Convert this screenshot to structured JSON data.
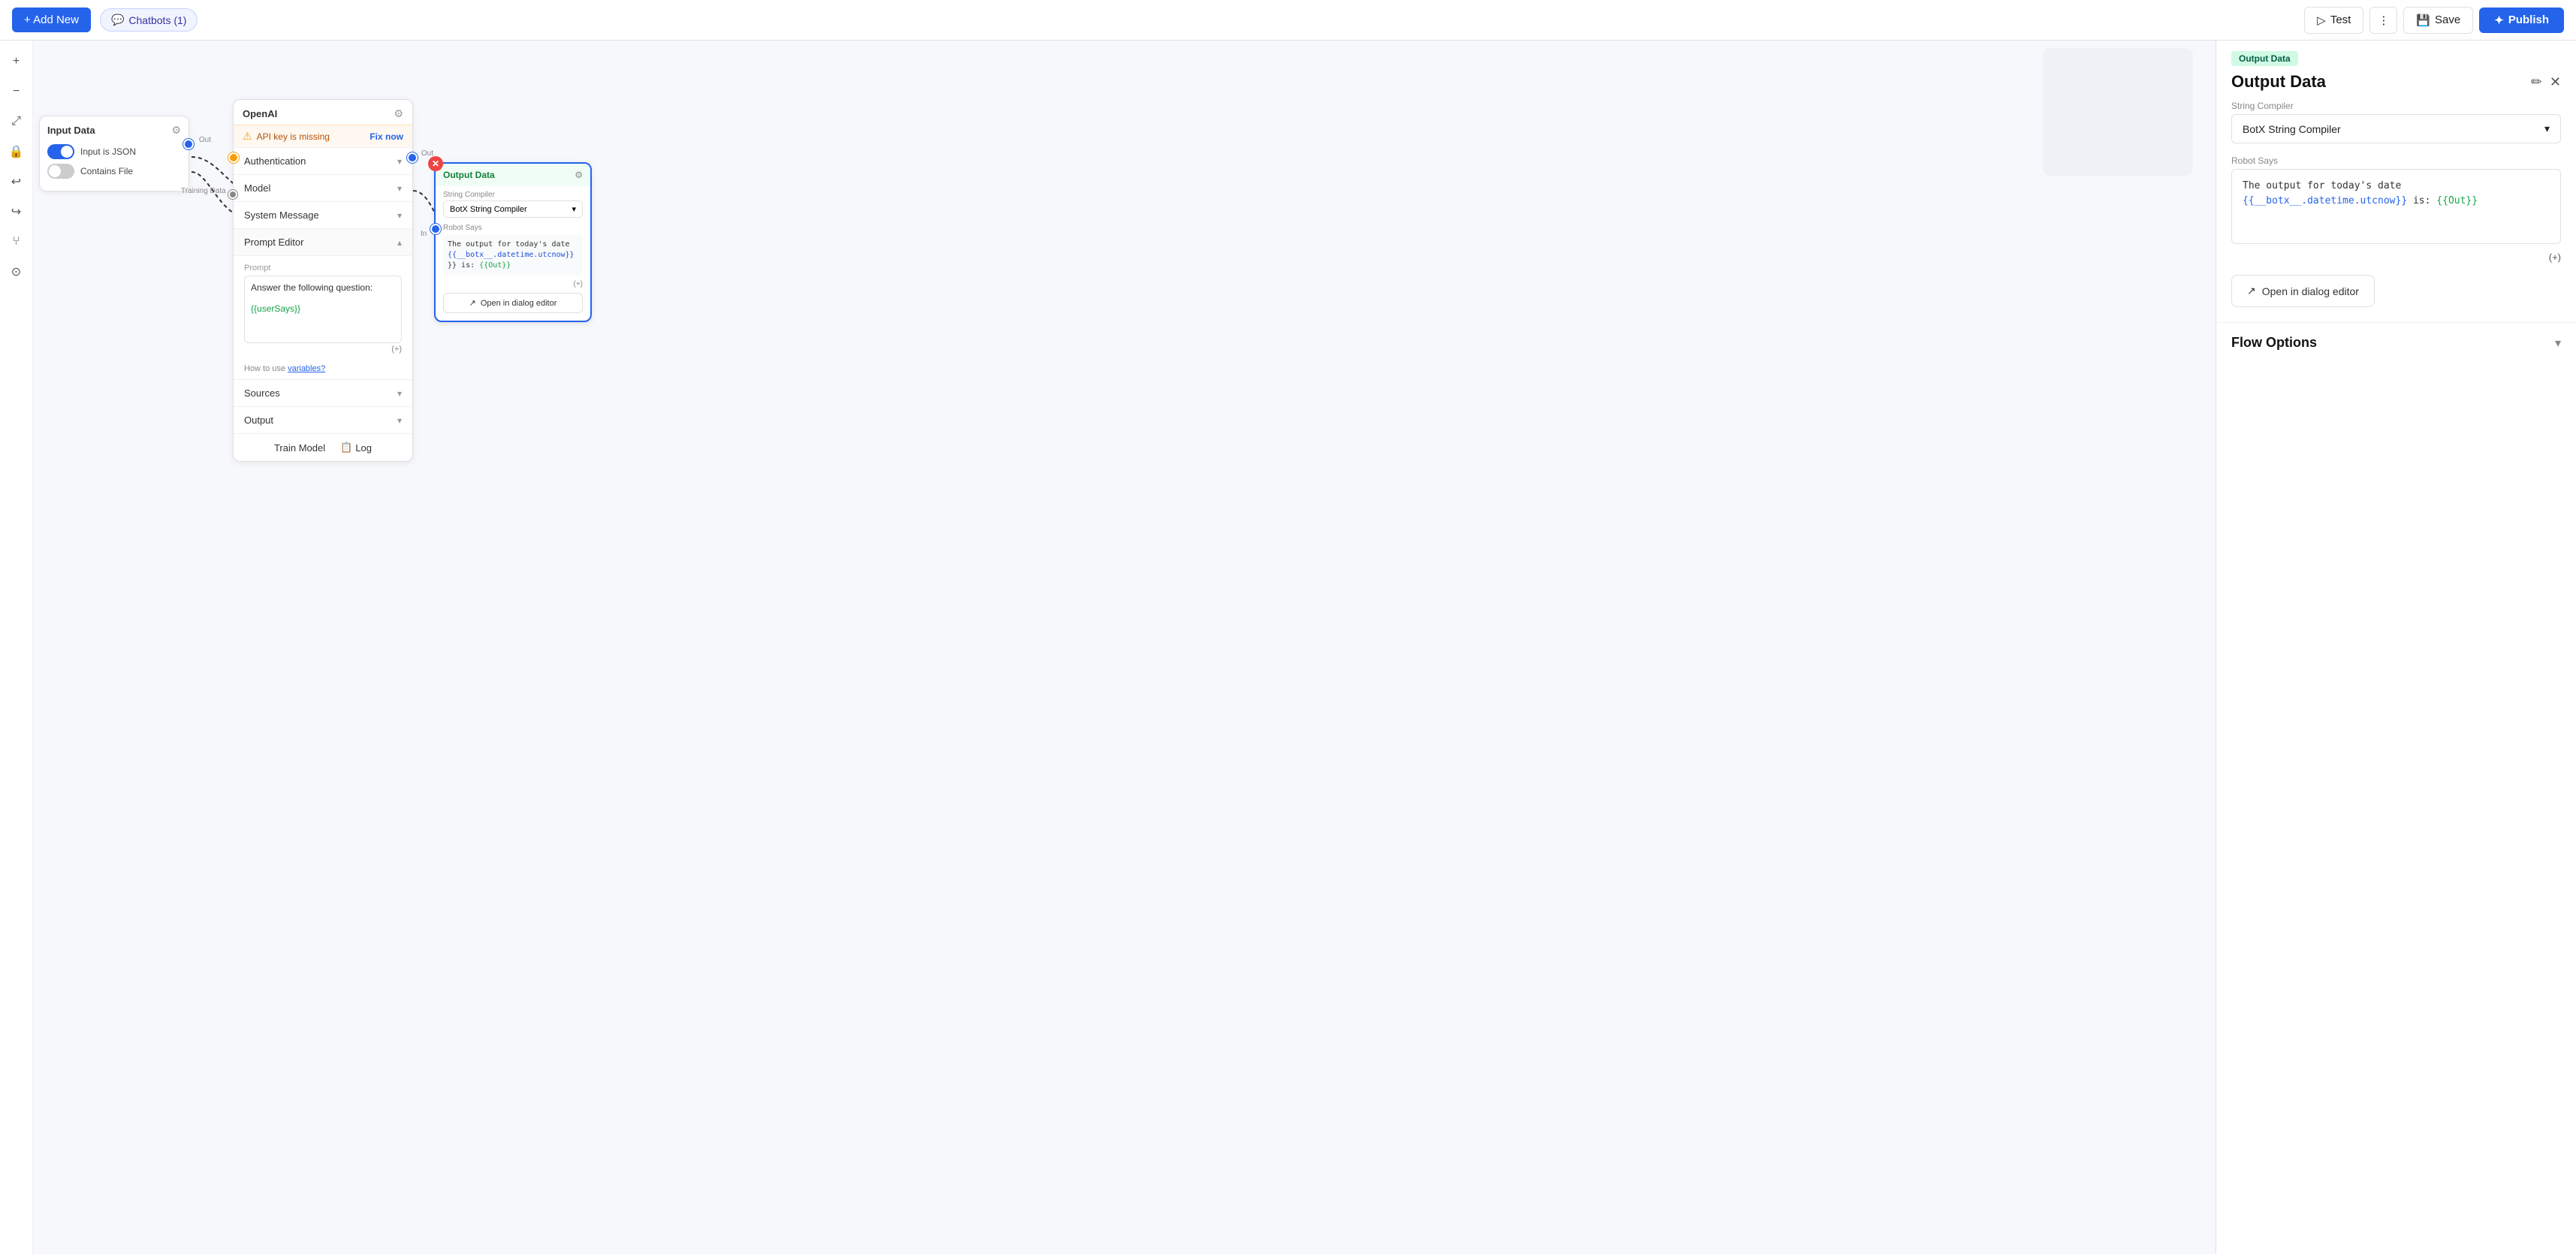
{
  "topbar": {
    "add_new_label": "+ Add New",
    "chatbots_label": "Chatbots (1)",
    "test_label": "Test",
    "save_label": "Save",
    "publish_label": "Publish"
  },
  "canvas": {
    "controls": {
      "zoom_in": "+",
      "zoom_out": "−",
      "fit": "⤢",
      "lock": "🔒",
      "undo": "↩",
      "redo": "↪",
      "branch": "⑂",
      "history": "⊙"
    }
  },
  "input_data_node": {
    "title": "Input Data",
    "input_is_json_label": "Input is JSON",
    "contains_file_label": "Contains File",
    "out_label": "Out",
    "training_data_label": "Training Data"
  },
  "openai_node": {
    "title": "OpenAI",
    "api_key_warning": "API key is missing",
    "fix_now_label": "Fix now",
    "authentication_label": "Authentication",
    "model_label": "Model",
    "system_message_label": "System Message",
    "prompt_editor_label": "Prompt Editor",
    "prompt_placeholder": "Prompt",
    "prompt_text": "Answer the following question:",
    "prompt_var": "{{userSays}}",
    "prompt_plus": "(+)",
    "how_to_use_prefix": "How to use ",
    "how_to_use_link": "variables?",
    "sources_label": "Sources",
    "output_label": "Output",
    "train_model_label": "Train Model",
    "log_label": "Log",
    "out_label": "Out"
  },
  "output_data_mini_node": {
    "title": "Output Data",
    "string_compiler_label": "String Compiler",
    "string_compiler_value": "BotX String Compiler",
    "robot_says_label": "Robot Says",
    "robot_says_text_line1": "The output for today's date",
    "robot_says_blue": "{{__botx__.datetime.utcnow}}",
    "robot_says_text_line2": "}} is: {{Out}}",
    "open_dialog_label": "Open in dialog editor",
    "plus_label": "(+)",
    "in_label": "In"
  },
  "right_panel": {
    "badge_label": "Output Data",
    "title": "Output Data",
    "edit_icon": "✏",
    "close_icon": "✕",
    "string_compiler_label": "String Compiler",
    "string_compiler_value": "BotX String Compiler",
    "robot_says_label": "Robot Says",
    "robot_says_text": "The output for today's date {{__botx__.datetime.utcnow}} is: {{Out}}",
    "robot_says_text_plain": "The output for today's date ",
    "robot_says_blue_var": "{{__botx__.datetime.utcnow}}",
    "robot_says_text2": " is: ",
    "robot_says_green_var": "{{Out}}",
    "plus_label": "(+)",
    "open_dialog_label": "Open in dialog editor",
    "flow_options_label": "Flow Options"
  }
}
